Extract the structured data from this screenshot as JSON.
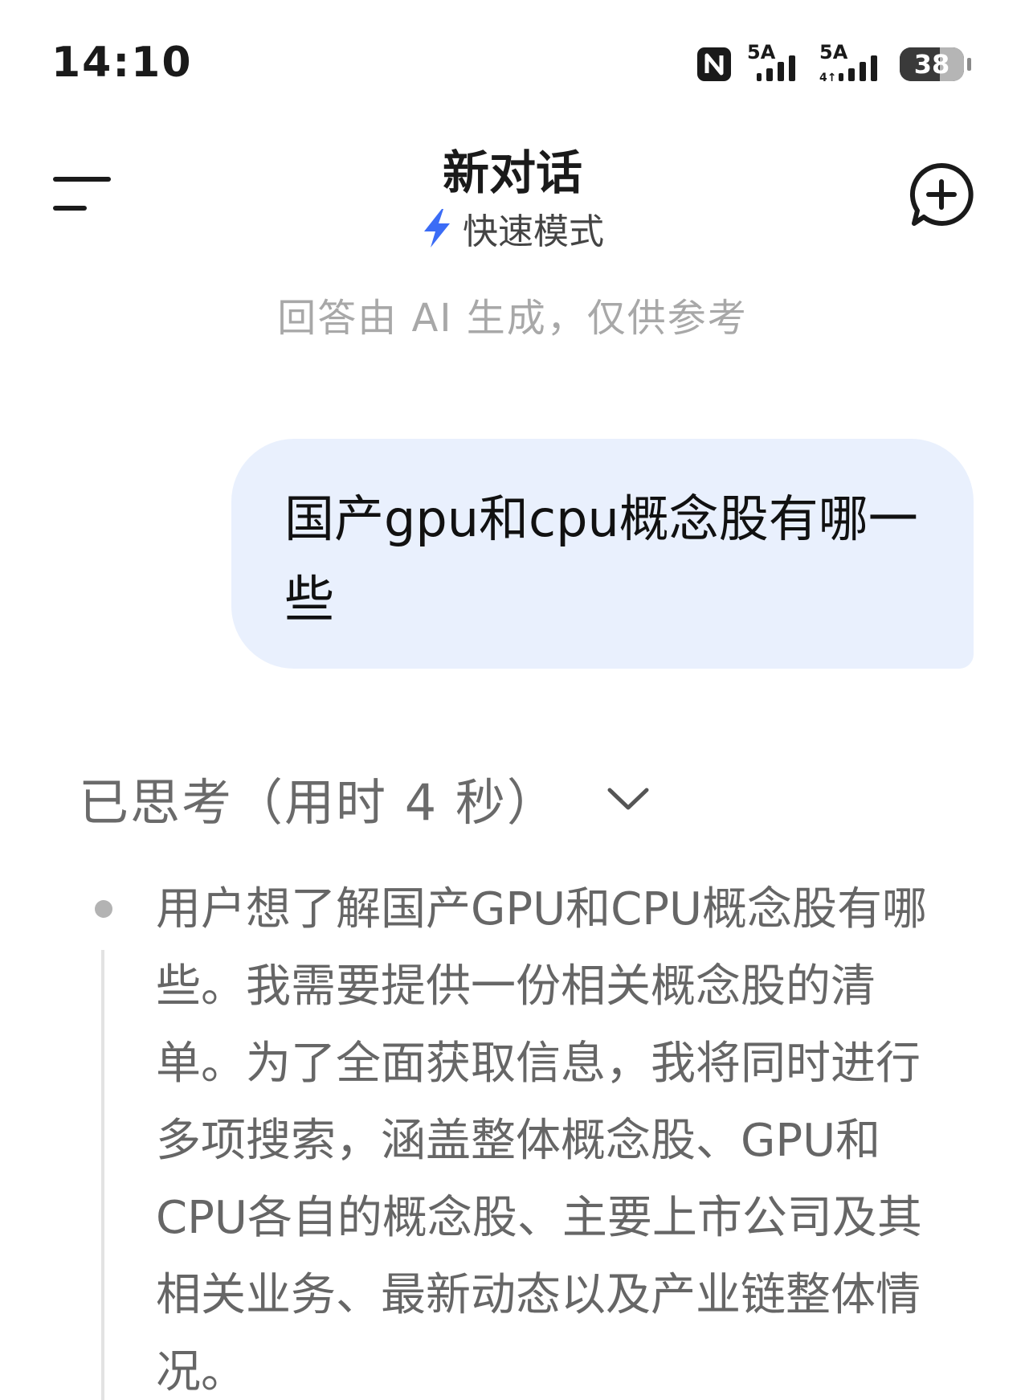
{
  "status_bar": {
    "time": "14:10",
    "icons": [
      "nfc-icon",
      "signal-5a-icon",
      "signal-5a-4g-icon",
      "battery-icon"
    ],
    "sim1_label": "5A",
    "sim2_label": "5A",
    "battery_level": "38"
  },
  "header": {
    "title": "新对话",
    "mode_label": "快速模式",
    "menu_icon": "menu-icon",
    "new_chat_icon": "new-chat-icon",
    "accent_color": "#3b6cf6"
  },
  "disclaimer": "回答由 AI 生成，仅供参考",
  "user_message": {
    "text": "国产gpu和cpu概念股有哪一些",
    "bubble_color": "#e9f0fd"
  },
  "thinking": {
    "label": "已思考（用时 4 秒）",
    "text": "用户想了解国产GPU和CPU概念股有哪些。我需要提供一份相关概念股的清单。为了全面获取信息，我将同时进行多项搜索，涵盖整体概念股、GPU和CPU各自的概念股、主要上市公司及其相关业务、最新动态以及产业链整体情况。"
  }
}
